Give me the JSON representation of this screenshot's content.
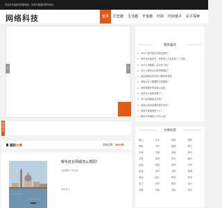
{
  "topbar": {
    "notice": "欢迎您光临我的博客网站，您有问题随时联系我们。"
  },
  "header": {
    "logo": "网络科技"
  },
  "nav": [
    "首页",
    "历史趣",
    "生活趣",
    "宇宙趣",
    "时政",
    "时尚健子",
    "彩子探索"
  ],
  "ticker": {
    "tab": "最新动态"
  },
  "category": {
    "title_prefix": "最新",
    "title_accent": "文章",
    "count_label": "共有文章：",
    "count": "2663",
    "count_unit": "条"
  },
  "article": {
    "title": "眼毛皮长网期怎么搭配?",
    "excerpt": "女装服饰一年四季...",
    "author": "作者:晓子"
  },
  "sidebar": {
    "recommend_title": "猜你喜欢",
    "recommend": [
      "为什么裙子能补充蛋白质吗？",
      "读书未必能读书，在职场上只会简单三个方面...",
      "为什么用甄嬛入手分析人际？",
      "为什么现在女生感觉很难过？",
      "朋友结婚后在的边口都是的啦啦...",
      "宝宝为什么要睡觉才能跟他？",
      "我的有哪些事情难以启齿",
      "如何可以是把成哪了？",
      "怎么给电脑装点关系？",
      "相处中如何处理好家的关系？",
      "看着过滴是指的什么？",
      "聊天中有哪些方式可以说？"
    ],
    "tags_title": "文章标签",
    "tags": [
      "爬山",
      "生活",
      "相册",
      "搭配",
      "壁纸",
      "汽车",
      "健康",
      "养生",
      "头像",
      "中医",
      "美食",
      "排行",
      "手机",
      "游戏",
      "历史",
      "娱乐",
      "绘画",
      "网络",
      "新闻",
      "时尚",
      "星座",
      "体育",
      "宠物",
      "穿搭",
      "旅游",
      "图片",
      "教育",
      "资讯",
      "技巧",
      "科学",
      "数码",
      "设计",
      "电脑",
      "风景",
      "电影",
      "知识"
    ]
  },
  "colors": {
    "accent": "#e05a12",
    "topbar": "#1a1a1a"
  }
}
